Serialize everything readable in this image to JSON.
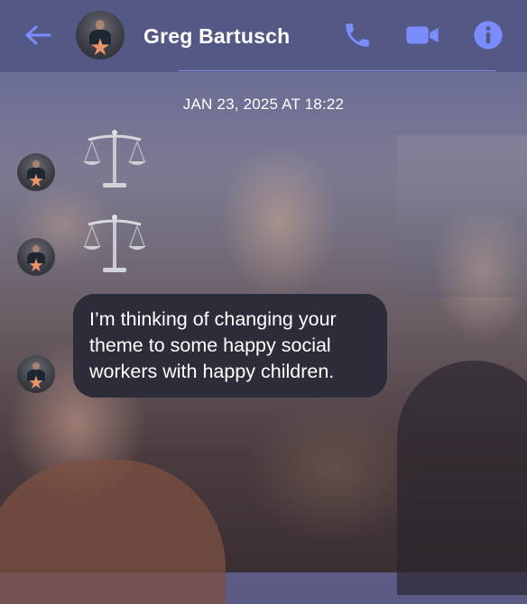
{
  "header": {
    "contact_name": "Greg Bartusch",
    "back_icon": "arrow-left-icon",
    "actions": [
      {
        "name": "phone-icon"
      },
      {
        "name": "video-camera-icon"
      },
      {
        "name": "info-icon"
      }
    ]
  },
  "conversation": {
    "date_label": "JAN 23, 2025 AT 18:22",
    "messages": [
      {
        "type": "emoji",
        "emoji": "scales-icon"
      },
      {
        "type": "emoji",
        "emoji": "scales-icon"
      },
      {
        "type": "text",
        "text": "I’m thinking of changing your theme to some happy social workers with happy children."
      }
    ]
  },
  "colors": {
    "accent": "#7b8cff",
    "header_bg": "#545885",
    "bubble_bg": "#2d2d3a",
    "text": "#ffffff"
  }
}
